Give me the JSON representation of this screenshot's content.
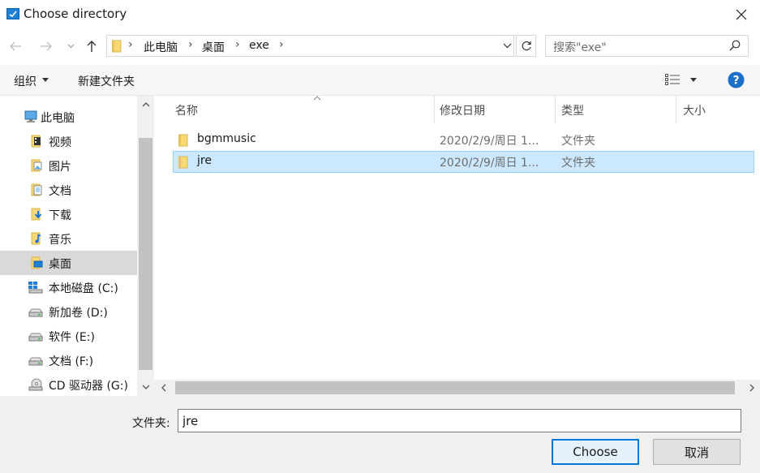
{
  "window": {
    "title": "Choose directory",
    "close_glyph": "✕"
  },
  "nav": {
    "breadcrumbs": [
      "此电脑",
      "桌面",
      "exe"
    ],
    "search_placeholder": "搜索\"exe\""
  },
  "toolbar": {
    "organize_label": "组织",
    "new_folder_label": "新建文件夹",
    "help_glyph": "?"
  },
  "sidebar": {
    "items": [
      {
        "label": "此电脑",
        "icon": "computer-icon"
      },
      {
        "label": "视频",
        "icon": "video-folder-icon"
      },
      {
        "label": "图片",
        "icon": "picture-folder-icon"
      },
      {
        "label": "文档",
        "icon": "document-folder-icon"
      },
      {
        "label": "下载",
        "icon": "download-folder-icon"
      },
      {
        "label": "音乐",
        "icon": "music-folder-icon"
      },
      {
        "label": "桌面",
        "icon": "desktop-folder-icon",
        "selected": true
      },
      {
        "label": "本地磁盘 (C:)",
        "icon": "windows-drive-icon"
      },
      {
        "label": "新加卷 (D:)",
        "icon": "drive-icon"
      },
      {
        "label": "软件 (E:)",
        "icon": "drive-icon"
      },
      {
        "label": "文档 (F:)",
        "icon": "drive-icon"
      },
      {
        "label": "CD 驱动器 (G:)",
        "icon": "cd-drive-icon"
      }
    ]
  },
  "columns": {
    "name": "名称",
    "modified": "修改日期",
    "type": "类型",
    "size": "大小"
  },
  "files": [
    {
      "name": "bgmmusic",
      "modified": "2020/2/9/周日 1...",
      "type": "文件夹",
      "selected": false
    },
    {
      "name": "jre",
      "modified": "2020/2/9/周日 1...",
      "type": "文件夹",
      "selected": true
    }
  ],
  "footer": {
    "folder_label": "文件夹:",
    "folder_value": "jre",
    "choose_label": "Choose",
    "cancel_label": "取消"
  },
  "colors": {
    "accent": "#0078d7",
    "selection": "#cce8ff",
    "folder": "#f8d775"
  }
}
